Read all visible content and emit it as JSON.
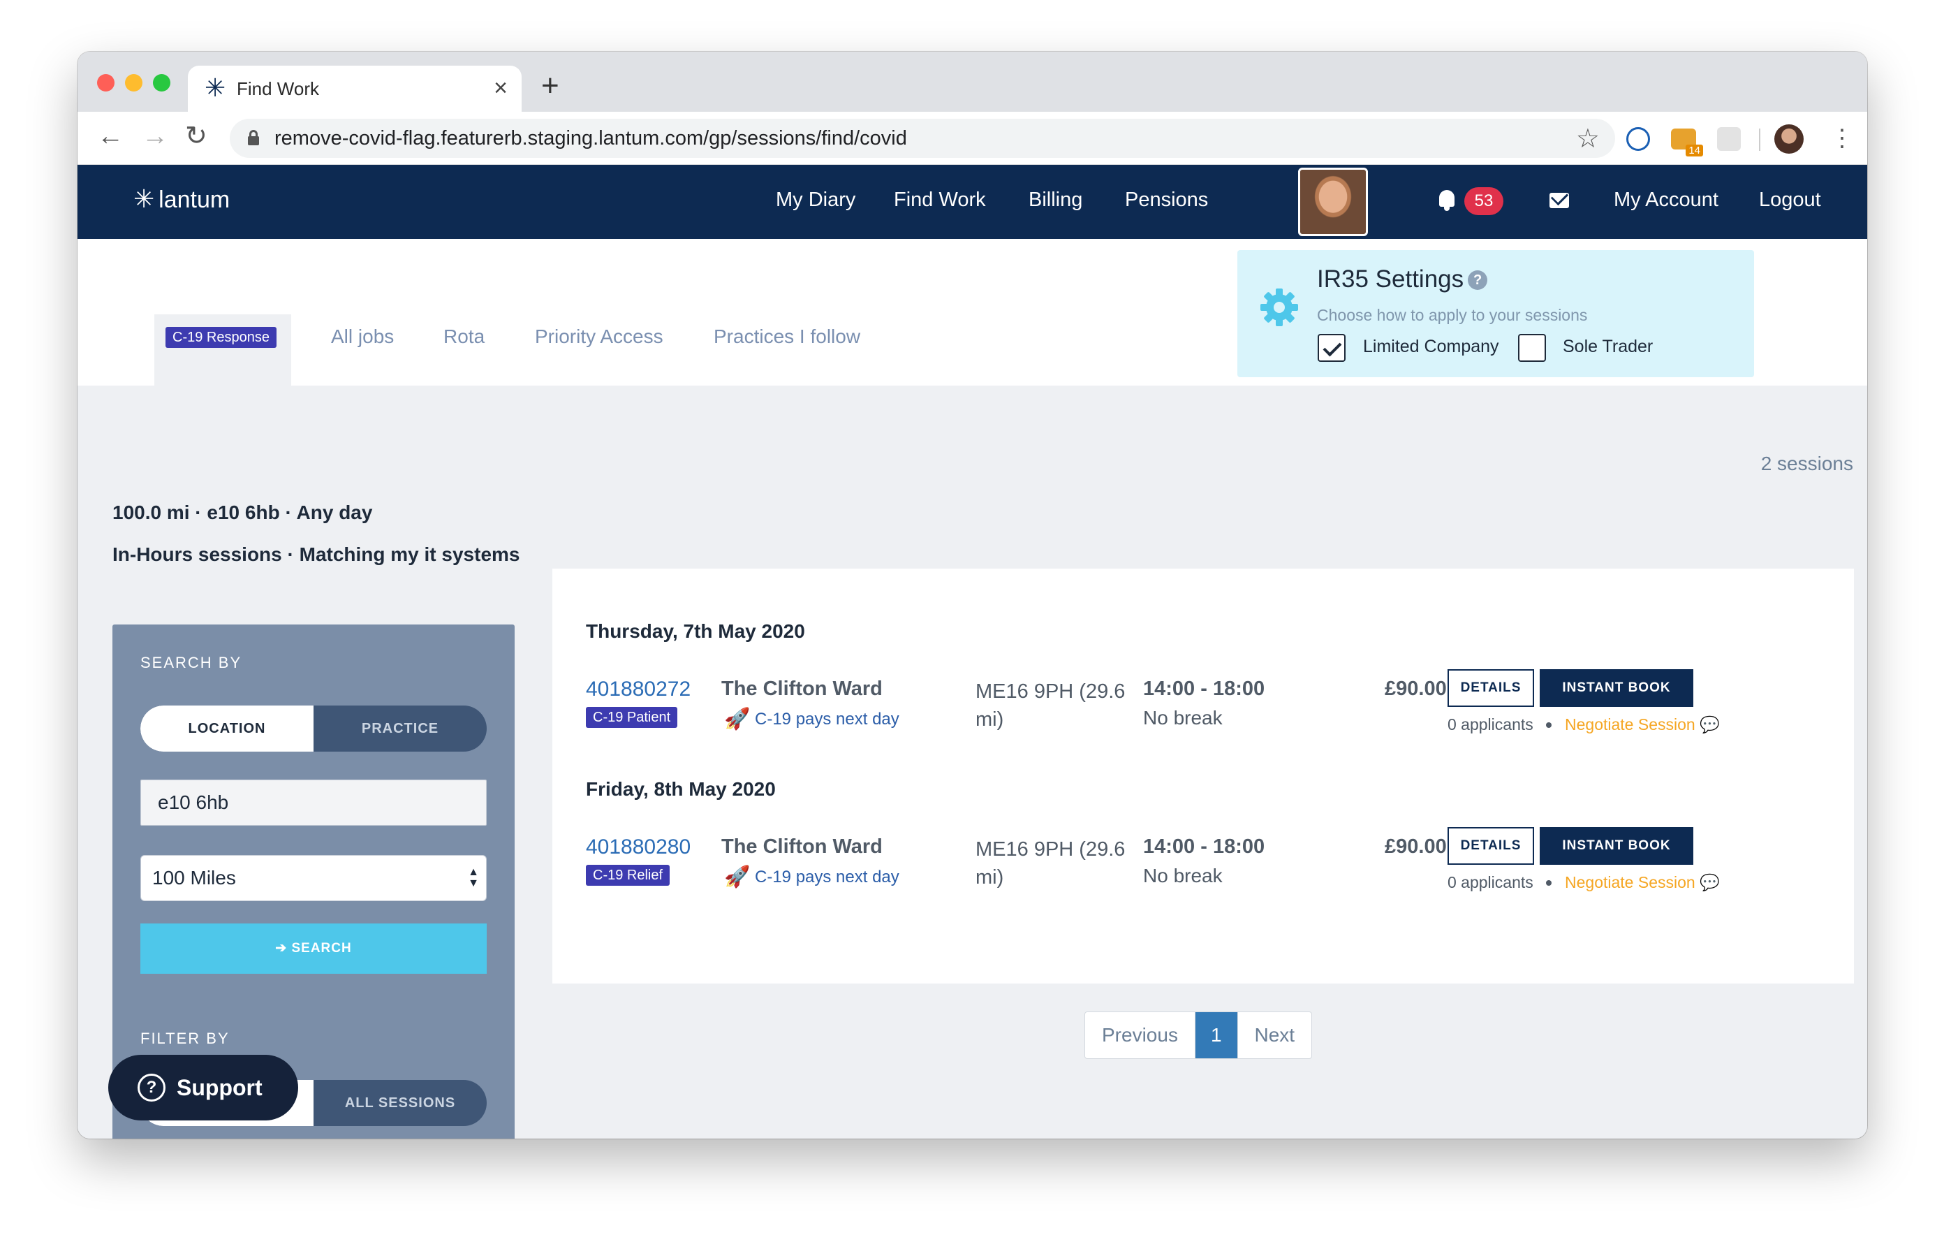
{
  "browser": {
    "tab_title": "Find Work",
    "tab_close": "×",
    "new_tab": "+",
    "url": "remove-covid-flag.featurerb.staging.lantum.com/gp/sessions/find/covid",
    "ext_badge": "14"
  },
  "navbar": {
    "brand": "lantum",
    "links": [
      "My Diary",
      "Find Work",
      "Billing",
      "Pensions"
    ],
    "notifications": "53",
    "my_account": "My Account",
    "logout": "Logout"
  },
  "subtabs": {
    "active_tag": "C-19 Response",
    "items": [
      "All jobs",
      "Rota",
      "Priority Access",
      "Practices I follow"
    ]
  },
  "ir35": {
    "title": "IR35 Settings",
    "subtitle": "Choose how to apply to your sessions",
    "help": "?",
    "option_limited": "Limited Company",
    "option_sole": "Sole Trader",
    "limited_checked": true,
    "sole_checked": false
  },
  "sessions_count": "2 sessions",
  "summary": {
    "line1": "100.0 mi · e10 6hb · Any day",
    "line2": "In-Hours sessions · Matching my it systems"
  },
  "sidebar": {
    "search_by": "SEARCH BY",
    "toggle_location": "LOCATION",
    "toggle_practice": "PRACTICE",
    "location_value": "e10 6hb",
    "distance": "100 Miles",
    "search_button": "SEARCH",
    "filter_by": "FILTER BY",
    "filter_all": "ALL SESSIONS"
  },
  "support": {
    "label": "Support"
  },
  "results": {
    "groups": [
      {
        "date": "Thursday, 7th May 2020",
        "id": "401880272",
        "tag": "C-19 Patient",
        "practice": "The Clifton Ward",
        "pays": "C-19 pays next day",
        "postcode": "ME16 9PH (29.6 mi)",
        "time": "14:00 - 18:00",
        "break": "No break",
        "rate": "£90.00",
        "details": "DETAILS",
        "instant_book": "INSTANT BOOK",
        "applicants": "0 applicants",
        "negotiate": "Negotiate Session"
      },
      {
        "date": "Friday, 8th May 2020",
        "id": "401880280",
        "tag": "C-19 Relief",
        "practice": "The Clifton Ward",
        "pays": "C-19 pays next day",
        "postcode": "ME16 9PH (29.6 mi)",
        "time": "14:00 - 18:00",
        "break": "No break",
        "rate": "£90.00",
        "details": "DETAILS",
        "instant_book": "INSTANT BOOK",
        "applicants": "0 applicants",
        "negotiate": "Negotiate Session"
      }
    ]
  },
  "pagination": {
    "previous": "Previous",
    "current": "1",
    "next": "Next"
  },
  "colors": {
    "navy": "#0d2a52",
    "accent": "#4ec7ea",
    "tag": "#3d3bb0",
    "link": "#2b6cb5",
    "negotiate": "#f5a623"
  }
}
